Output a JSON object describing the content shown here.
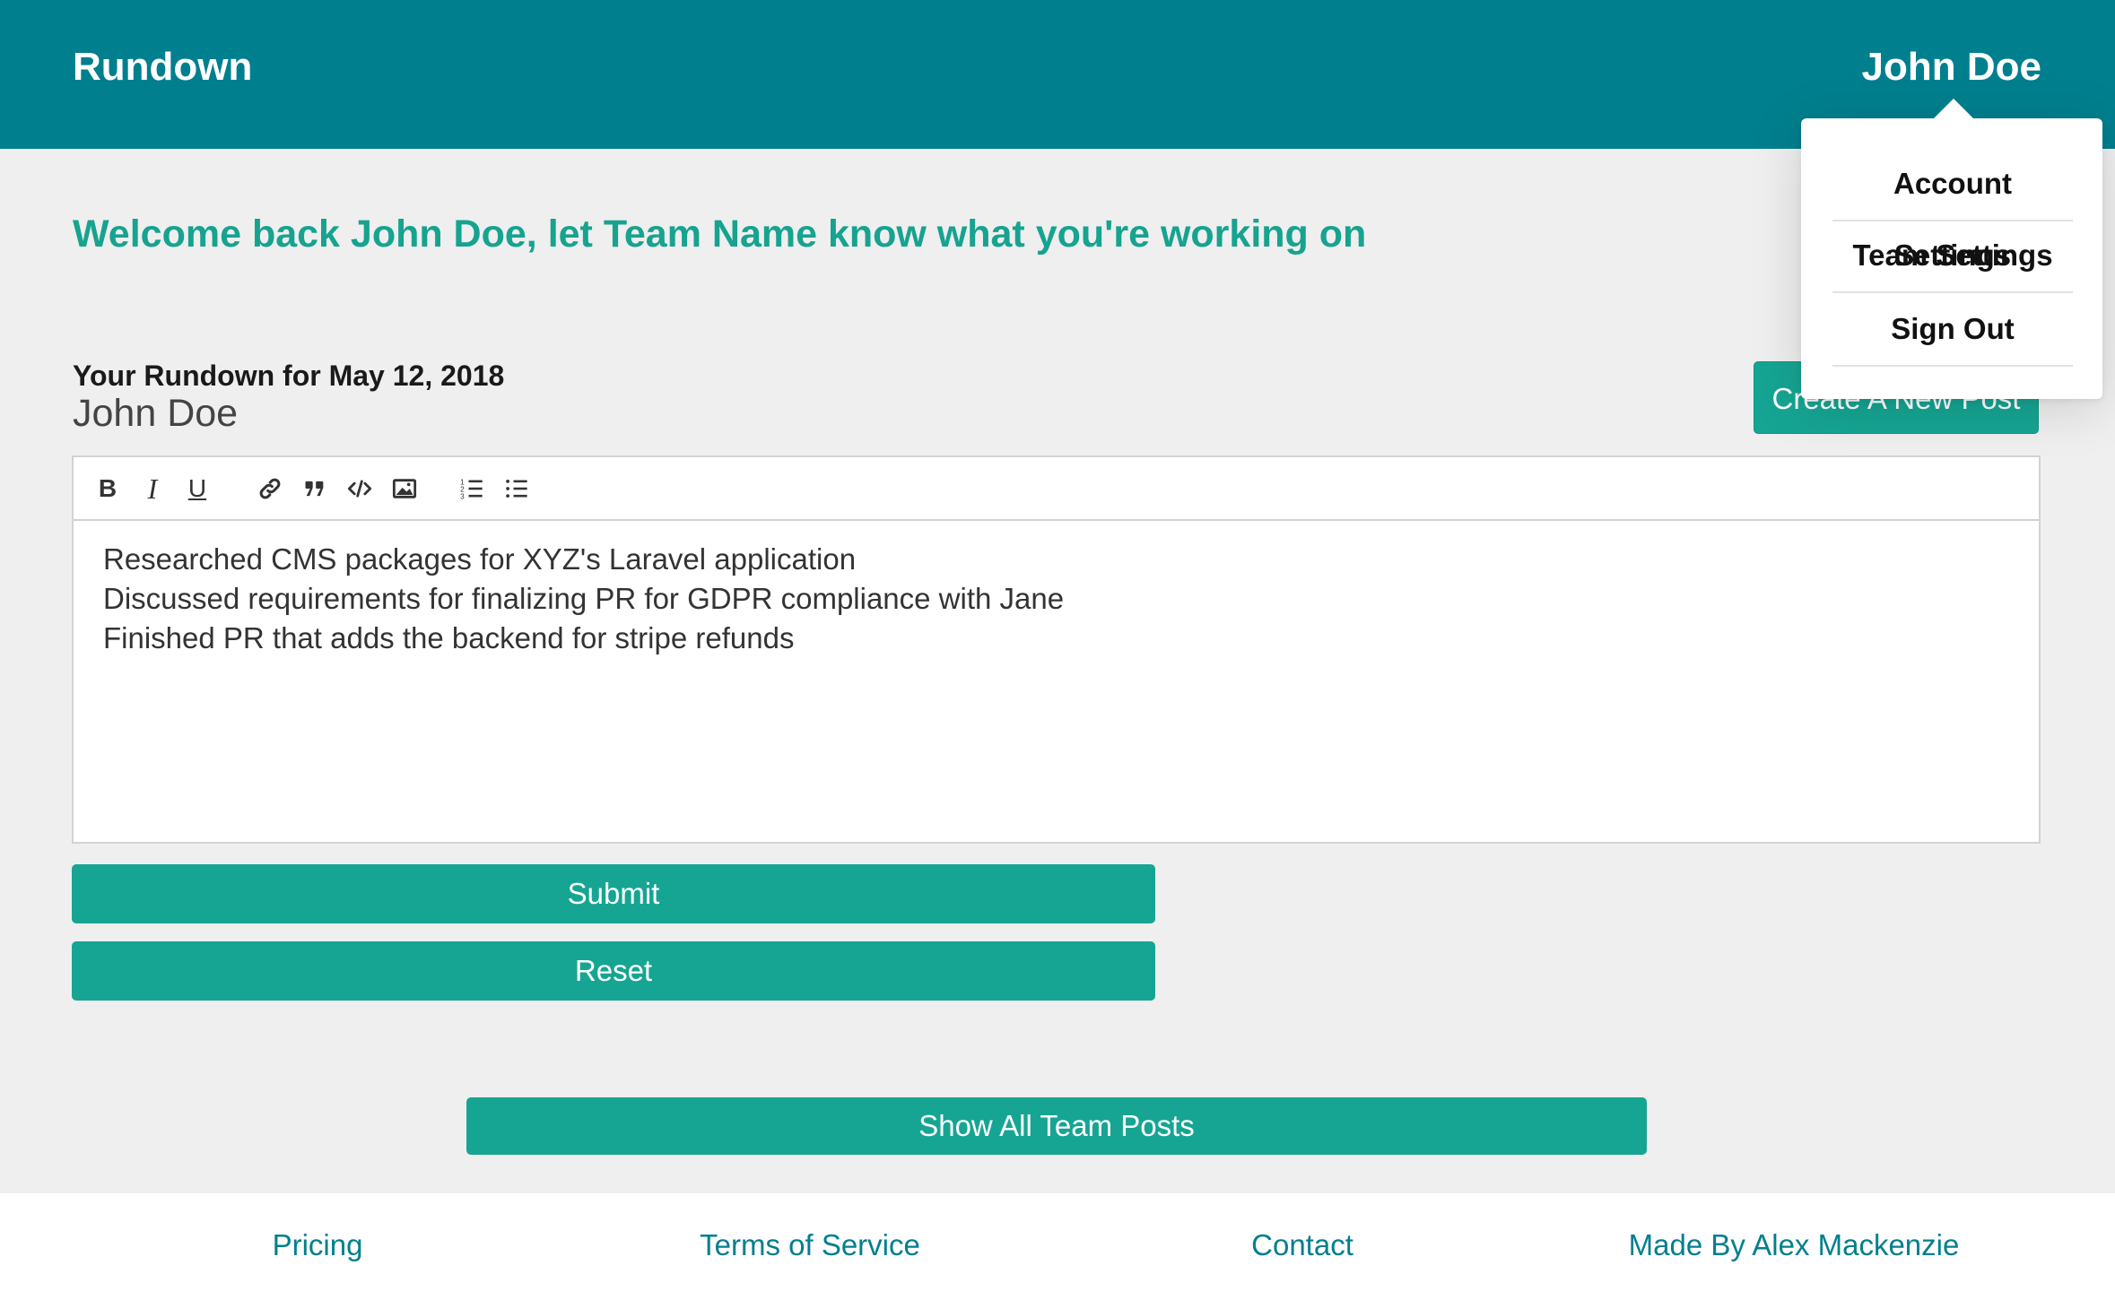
{
  "header": {
    "brand": "Rundown",
    "user_name": "John Doe",
    "colors": {
      "header_bg": "#007f8e",
      "accent": "#16a593"
    }
  },
  "dropdown": {
    "items": [
      {
        "label": "Account Settings"
      },
      {
        "label": "Team Settings"
      },
      {
        "label": "Sign Out"
      }
    ]
  },
  "main": {
    "welcome": "Welcome back John Doe, let Team Name know what you're working on",
    "rundown_date": "Your Rundown for May 12, 2018",
    "author": "John Doe",
    "create_button": "Create A New Post"
  },
  "editor": {
    "toolbar": {
      "bold": "B",
      "italic": "I",
      "underline": "U",
      "icons": [
        "link-icon",
        "quote-icon",
        "code-icon",
        "image-icon",
        "ordered-list-icon",
        "bullet-list-icon"
      ]
    },
    "lines": [
      "Researched CMS packages for XYZ's Laravel application",
      "Discussed requirements for finalizing PR for GDPR compliance with Jane",
      "Finished PR that adds the backend for stripe refunds"
    ]
  },
  "actions": {
    "submit": "Submit",
    "reset": "Reset",
    "show_all": "Show All Team Posts"
  },
  "footer": {
    "links": [
      {
        "label": "Pricing"
      },
      {
        "label": "Terms of Service"
      },
      {
        "label": "Contact"
      },
      {
        "label": "Made By Alex Mackenzie"
      }
    ]
  }
}
